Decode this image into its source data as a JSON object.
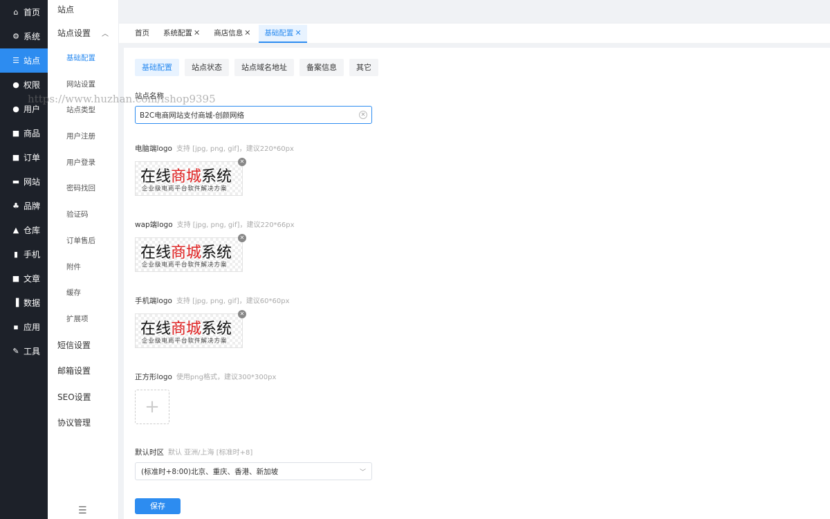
{
  "nav": {
    "items": [
      {
        "label": "首页",
        "icon": "home-icon",
        "glyph": "⌂"
      },
      {
        "label": "系统",
        "icon": "gear-icon",
        "glyph": "⚙"
      },
      {
        "label": "站点",
        "icon": "sliders-icon",
        "glyph": "☰"
      },
      {
        "label": "权限",
        "icon": "user-lock-icon",
        "glyph": "●"
      },
      {
        "label": "用户",
        "icon": "user-icon",
        "glyph": "●"
      },
      {
        "label": "商品",
        "icon": "box-icon",
        "glyph": "■"
      },
      {
        "label": "订单",
        "icon": "order-icon",
        "glyph": "■"
      },
      {
        "label": "网站",
        "icon": "monitor-icon",
        "glyph": "▬"
      },
      {
        "label": "品牌",
        "icon": "brand-icon",
        "glyph": "♣"
      },
      {
        "label": "仓库",
        "icon": "warehouse-icon",
        "glyph": "▲"
      },
      {
        "label": "手机",
        "icon": "phone-icon",
        "glyph": "▮"
      },
      {
        "label": "文章",
        "icon": "article-icon",
        "glyph": "■"
      },
      {
        "label": "数据",
        "icon": "chart-icon",
        "glyph": "▐"
      },
      {
        "label": "应用",
        "icon": "apps-icon",
        "glyph": "▪"
      },
      {
        "label": "工具",
        "icon": "wrench-icon",
        "glyph": "✎"
      }
    ],
    "active_index": 2
  },
  "sidebar": {
    "title": "站点",
    "group_open": "站点设置",
    "children": [
      "基础配置",
      "网站设置",
      "站点类型",
      "用户注册",
      "用户登录",
      "密码找回",
      "验证码",
      "订单售后",
      "附件",
      "缓存",
      "扩展项"
    ],
    "active_child": 0,
    "groups": [
      "短信设置",
      "邮箱设置",
      "SEO设置",
      "协议管理"
    ]
  },
  "tabs": [
    {
      "label": "首页",
      "closable": false
    },
    {
      "label": "系统配置",
      "closable": true
    },
    {
      "label": "商店信息",
      "closable": true
    },
    {
      "label": "基础配置",
      "closable": true
    }
  ],
  "active_tab": 3,
  "subtabs": [
    "基础配置",
    "站点状态",
    "站点域名地址",
    "备案信息",
    "其它"
  ],
  "active_subtab": 0,
  "form": {
    "site_name": {
      "label": "站点名称",
      "value": "B2C电商网站支付商城-创颜网络"
    },
    "pc_logo": {
      "label": "电脑端logo",
      "hint": "支持 [jpg, png, gif]，建议220*60px"
    },
    "wap_logo": {
      "label": "wap端logo",
      "hint": "支持 [jpg, png, gif]，建议220*66px"
    },
    "mobile_logo": {
      "label": "手机端logo",
      "hint": "支持 [jpg, png, gif]，建议60*60px"
    },
    "square_logo": {
      "label": "正方形logo",
      "hint": "使用png格式，建议300*300px"
    },
    "timezone": {
      "label": "默认时区",
      "hint": "默认 亚洲/上海 [标准时+8]",
      "value": "(标准时+8:00)北京、重庆、香港、新加坡"
    },
    "save_label": "保存"
  },
  "logo_image": {
    "part1": "在线",
    "part2": "商城",
    "part3": "系统",
    "tagline": "企业级电商平台软件解决方案"
  },
  "watermark": "https://www.huzhan.com/ishop9395",
  "colors": {
    "primary": "#2d8cf0",
    "nav_bg": "#1d2129",
    "logo_red": "#e02020"
  }
}
